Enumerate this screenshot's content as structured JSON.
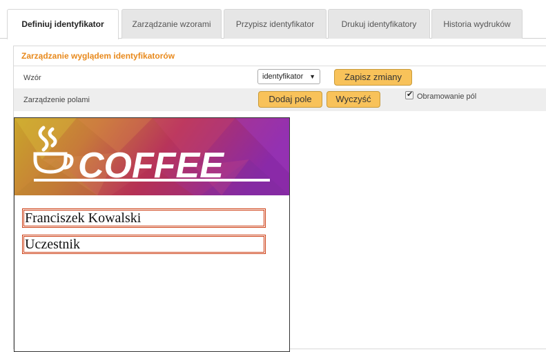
{
  "tabs": [
    {
      "label": "Definiuj identyfikator",
      "active": true
    },
    {
      "label": "Zarządzanie wzorami"
    },
    {
      "label": "Przypisz identyfikator"
    },
    {
      "label": "Drukuj identyfikatory"
    },
    {
      "label": "Historia wydruków"
    }
  ],
  "panel": {
    "title": "Zarządzanie wyglądem identyfikatorów",
    "template_row": {
      "label": "Wzór",
      "select_value": "identyfikator",
      "save_button": "Zapisz zmiany"
    },
    "fields_row": {
      "label": "Zarządzenie polami",
      "add_button": "Dodaj pole",
      "clear_button": "Wyczyść",
      "border_checkbox_label": "Obramowanie pól",
      "border_checked": true
    }
  },
  "badge": {
    "logo_text": "COFFEE",
    "fields": [
      "Franciszek Kowalski",
      "Uczestnik"
    ]
  },
  "colors": {
    "accent": "#e8891c",
    "button": "#f8c25a",
    "field_border": "#cc3b10"
  }
}
